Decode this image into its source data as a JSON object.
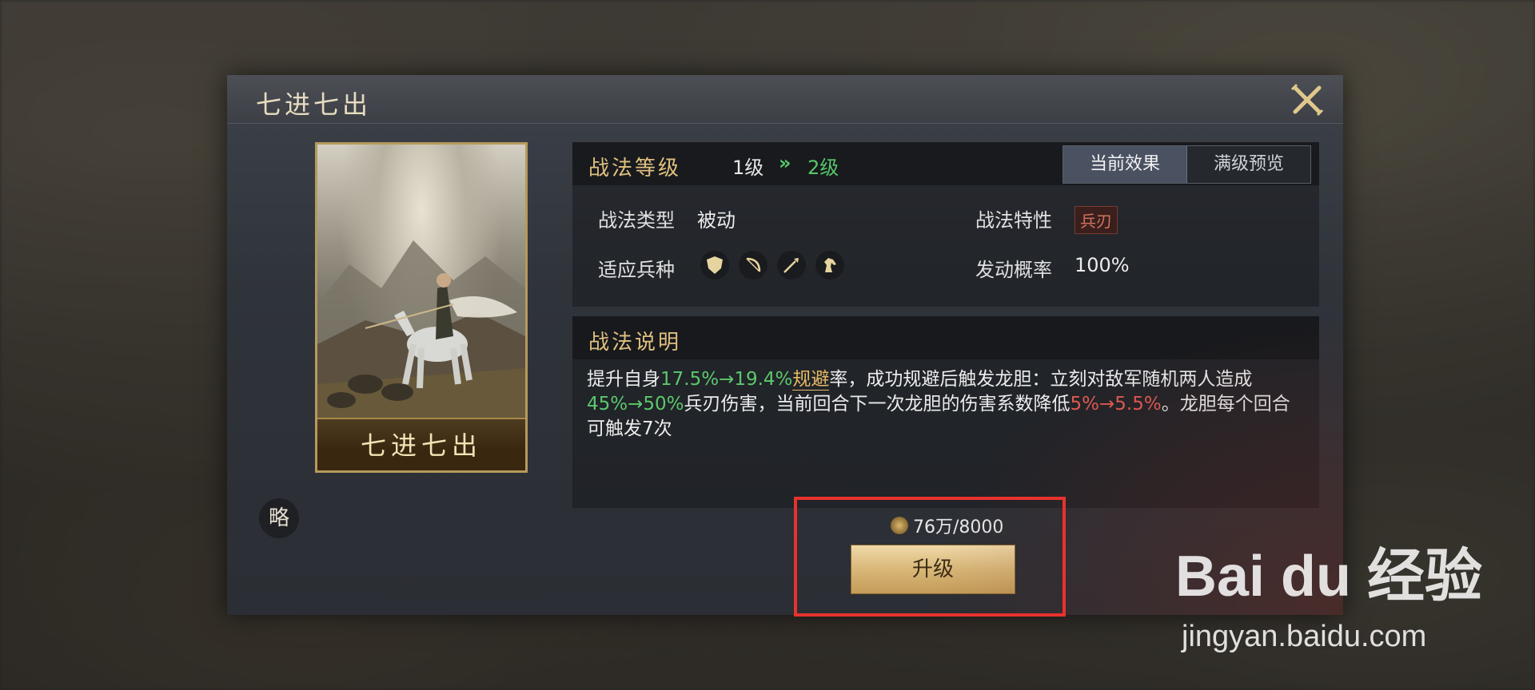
{
  "dialog": {
    "title": "七进七出",
    "card_name": "七进七出",
    "strategy_badge": "略"
  },
  "level": {
    "label": "战法等级",
    "from": "1级",
    "arrow": "»",
    "to": "2级"
  },
  "tabs": [
    {
      "label": "当前效果",
      "active": true
    },
    {
      "label": "满级预览",
      "active": false
    }
  ],
  "attributes": {
    "type_label": "战法类型",
    "type_value": "被动",
    "trait_label": "战法特性",
    "trait_value": "兵刃",
    "troop_label": "适应兵种",
    "troop_icons": [
      "shield-icon",
      "bow-icon",
      "spear-icon",
      "horse-icon"
    ],
    "rate_label": "发动概率",
    "rate_value": "100%"
  },
  "description": {
    "label": "战法说明",
    "t1": "提升自身",
    "t2": "17.5%→19.4%",
    "t3": "规避",
    "t4": "率，成功规避后触发龙胆：立刻对敌军随机两人造成",
    "t5": "45%→50%",
    "t6": "兵刃伤害，当前回合下一次龙胆的伤害系数降低",
    "t7": "5%→5.5%",
    "t8": "。龙胆每个回合可触发7次"
  },
  "upgrade": {
    "cost": "76万/8000",
    "button_label": "升级"
  },
  "watermark": {
    "brand": "Bai du 经验",
    "url": "jingyan.baidu.com"
  },
  "colors": {
    "accent_gold": "#e0c07e",
    "highlight_green": "#5cc86c",
    "highlight_red": "#e25a52",
    "highlight_box": "#e8322e"
  }
}
